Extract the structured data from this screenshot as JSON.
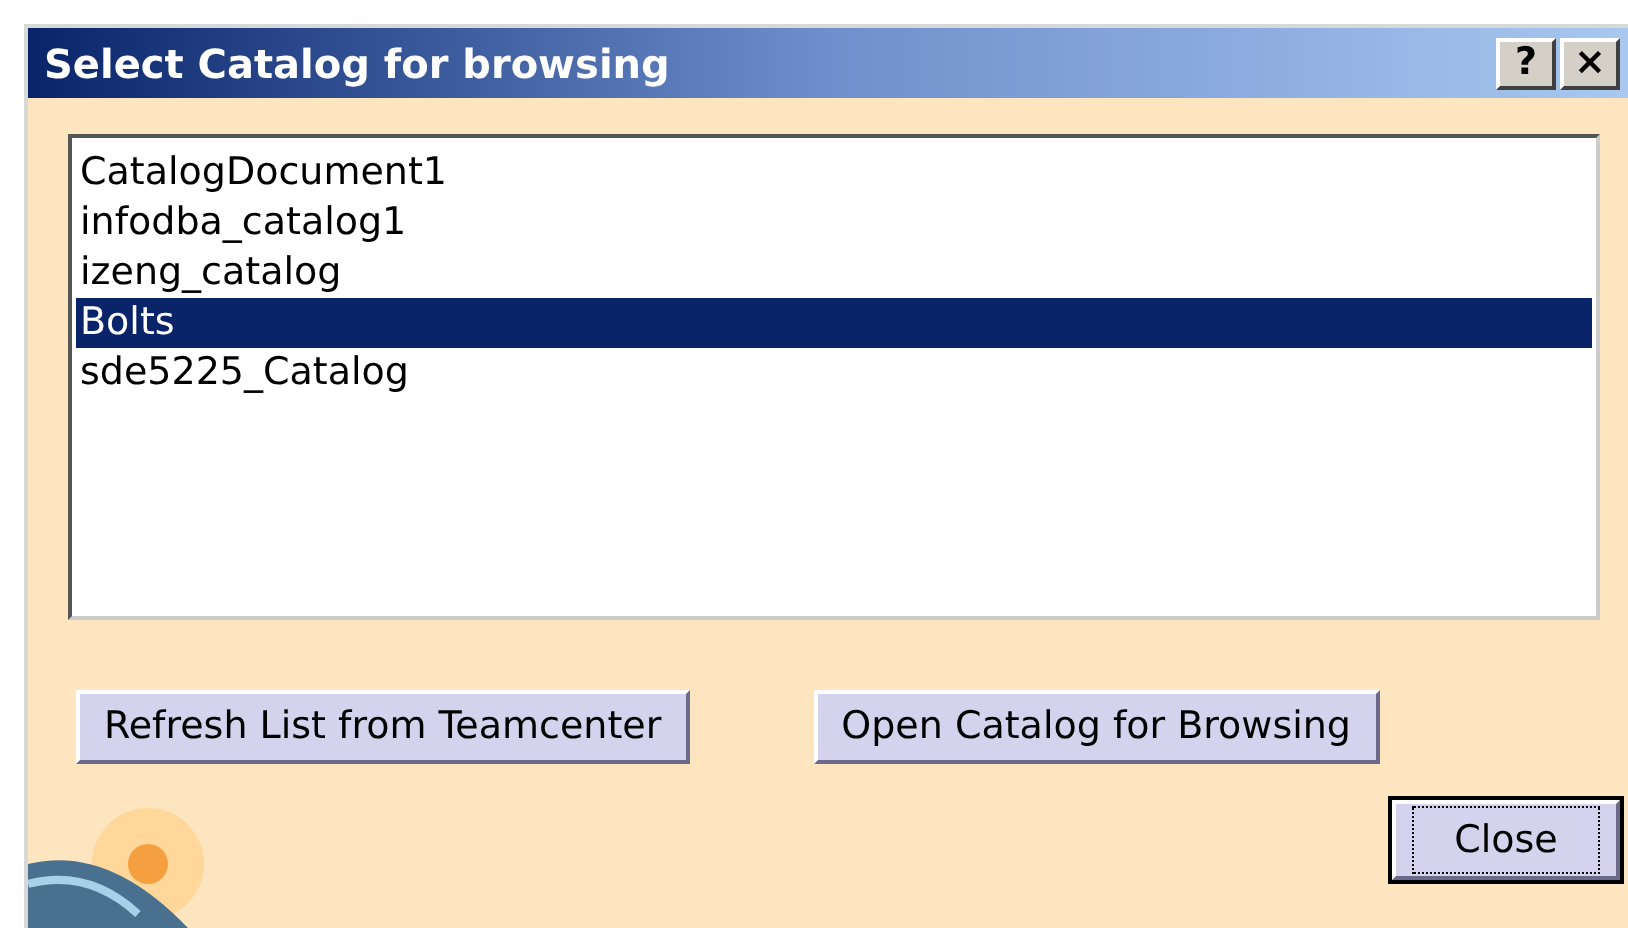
{
  "window": {
    "title": "Select Catalog for browsing",
    "title_buttons": [
      "?",
      "×"
    ]
  },
  "catalogs": [
    {
      "label": "CatalogDocument1",
      "selected": false
    },
    {
      "label": "infodba_catalog1",
      "selected": false
    },
    {
      "label": "izeng_catalog",
      "selected": false
    },
    {
      "label": "Bolts",
      "selected": true
    },
    {
      "label": "sde5225_Catalog",
      "selected": false
    }
  ],
  "buttons": [
    {
      "label": "Refresh List from Teamcenter",
      "focused": false
    },
    {
      "label": "Open Catalog for Browsing",
      "focused": false
    }
  ],
  "close_button": {
    "label": "Close",
    "focused": true
  }
}
